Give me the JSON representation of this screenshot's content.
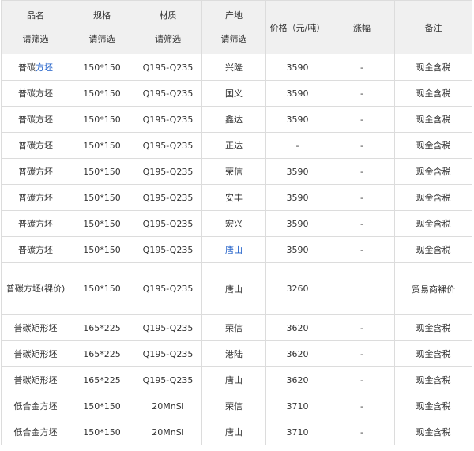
{
  "header": {
    "name": {
      "label": "品名",
      "filter": "请筛选"
    },
    "spec": {
      "label": "规格",
      "filter": "请筛选"
    },
    "material": {
      "label": "材质",
      "filter": "请筛选"
    },
    "origin": {
      "label": "产地",
      "filter": "请筛选"
    },
    "price": {
      "label": "价格（元/吨）"
    },
    "change": {
      "label": "涨幅"
    },
    "note": {
      "label": "备注"
    }
  },
  "rows": [
    {
      "name_a": "普碳",
      "name_b": "方坯",
      "spec": "150*150",
      "material": "Q195-Q235",
      "origin": "兴隆",
      "price": "3590",
      "change": "-",
      "note": "现金含税"
    },
    {
      "name": "普碳方坯",
      "spec": "150*150",
      "material": "Q195-Q235",
      "origin": "国义",
      "price": "3590",
      "change": "-",
      "note": "现金含税"
    },
    {
      "name": "普碳方坯",
      "spec": "150*150",
      "material": "Q195-Q235",
      "origin": "鑫达",
      "price": "3590",
      "change": "-",
      "note": "现金含税"
    },
    {
      "name": "普碳方坯",
      "spec": "150*150",
      "material": "Q195-Q235",
      "origin": "正达",
      "price": "-",
      "change": "-",
      "note": "现金含税"
    },
    {
      "name": "普碳方坯",
      "spec": "150*150",
      "material": "Q195-Q235",
      "origin": "荣信",
      "price": "3590",
      "change": "-",
      "note": "现金含税"
    },
    {
      "name": "普碳方坯",
      "spec": "150*150",
      "material": "Q195-Q235",
      "origin": "安丰",
      "price": "3590",
      "change": "-",
      "note": "现金含税"
    },
    {
      "name": "普碳方坯",
      "spec": "150*150",
      "material": "Q195-Q235",
      "origin": "宏兴",
      "price": "3590",
      "change": "-",
      "note": "现金含税"
    },
    {
      "name": "普碳方坯",
      "spec": "150*150",
      "material": "Q195-Q235",
      "origin": "唐山",
      "price": "3590",
      "change": "-",
      "note": "现金含税"
    },
    {
      "name": "普碳方坯(裸价)",
      "spec": "150*150",
      "material": "Q195-Q235",
      "origin": "唐山",
      "price": "3260",
      "change": "",
      "note": "贸易商裸价"
    },
    {
      "name": "普碳矩形坯",
      "spec": "165*225",
      "material": "Q195-Q235",
      "origin": "荣信",
      "price": "3620",
      "change": "-",
      "note": "现金含税"
    },
    {
      "name": "普碳矩形坯",
      "spec": "165*225",
      "material": "Q195-Q235",
      "origin": "港陆",
      "price": "3620",
      "change": "-",
      "note": "现金含税"
    },
    {
      "name": "普碳矩形坯",
      "spec": "165*225",
      "material": "Q195-Q235",
      "origin": "唐山",
      "price": "3620",
      "change": "-",
      "note": "现金含税"
    },
    {
      "name": "低合金方坯",
      "spec": "150*150",
      "material": "20MnSi",
      "origin": "荣信",
      "price": "3710",
      "change": "-",
      "note": "现金含税"
    },
    {
      "name": "低合金方坯",
      "spec": "150*150",
      "material": "20MnSi",
      "origin": "唐山",
      "price": "3710",
      "change": "-",
      "note": "现金含税"
    }
  ]
}
